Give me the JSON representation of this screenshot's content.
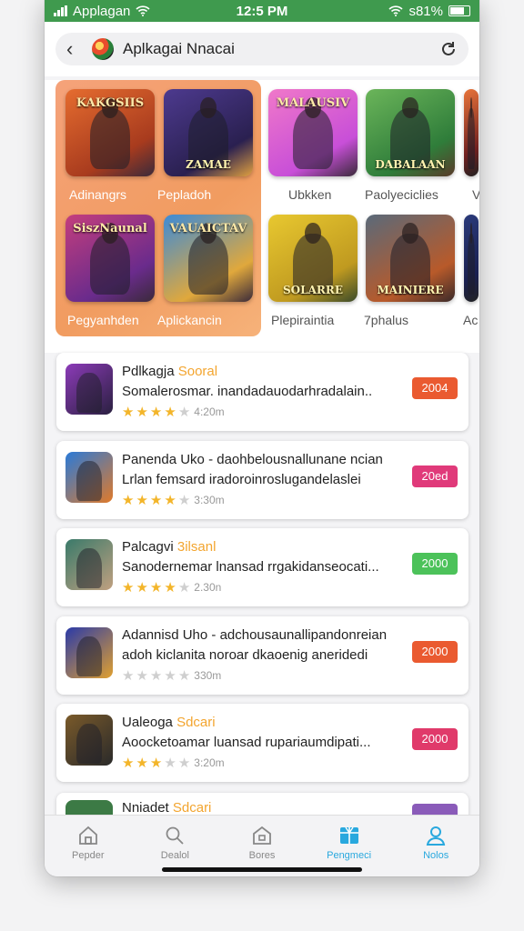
{
  "status_bar": {
    "carrier": "Applagan",
    "time": "12:5 PM",
    "battery_text": "s81%"
  },
  "header": {
    "title": "Aplkagai Nnacai"
  },
  "featured": {
    "tiles": [
      {
        "name": "Adinangrs",
        "top_label": "KAKGSIIS",
        "bottom_label": "",
        "colors": [
          "#e56c2f",
          "#a83b1e",
          "#3a2a3a"
        ]
      },
      {
        "name": "Pepladoh",
        "top_label": "",
        "bottom_label": "ZAMAE",
        "colors": [
          "#4d3a8f",
          "#2a2050",
          "#e0a040"
        ]
      },
      {
        "name": "Ubkken",
        "top_label": "MALAUSIV",
        "bottom_label": "",
        "colors": [
          "#f078c9",
          "#c84fd8",
          "#3a2a3a"
        ]
      },
      {
        "name": "Paolyeciclies",
        "top_label": "",
        "bottom_label": "DABALAAN",
        "colors": [
          "#6bb55a",
          "#2f7d3a",
          "#5a3a2a"
        ]
      },
      {
        "name": "V",
        "top_label": "",
        "bottom_label": "",
        "colors": [
          "#e8743a",
          "#702020",
          "#222"
        ]
      },
      {
        "name": "Pegyanhden",
        "top_label": "SiszNaunal",
        "bottom_label": "",
        "colors": [
          "#c43e7d",
          "#6a2b8c",
          "#3a2a3a"
        ]
      },
      {
        "name": "Aplickancin",
        "top_label": "VAUAICTAV",
        "bottom_label": "",
        "colors": [
          "#3c8bd8",
          "#e0a83c",
          "#3a2a3a"
        ]
      },
      {
        "name": "Plepiraintia",
        "top_label": "",
        "bottom_label": "SOLARRE",
        "colors": [
          "#e8c830",
          "#c09a20",
          "#3a4a2a"
        ]
      },
      {
        "name": "7phalus",
        "top_label": "",
        "bottom_label": "MAINIERE",
        "colors": [
          "#5a6a7a",
          "#b85a2a",
          "#3a2a2a"
        ]
      },
      {
        "name": "Ac",
        "top_label": "",
        "bottom_label": "",
        "colors": [
          "#2a3a7a",
          "#1a2050",
          "#222"
        ]
      }
    ]
  },
  "list": {
    "items": [
      {
        "name": "Pdlkagja",
        "tag": "Sooral",
        "description": "Somalerosmar. inandadauodarhradalain..",
        "rating": 4,
        "half": true,
        "size": "4:20m",
        "price": "2004",
        "price_color": "#ea5a30",
        "icon_colors": [
          "#8c3bb8",
          "#2a2040"
        ]
      },
      {
        "name": "Panenda Uko - daohbelousnallunane ncian",
        "tag": "",
        "description": "Lrlan femsard iradoroinroslugandelaslei",
        "rating": 4,
        "half": false,
        "size": "3:30m",
        "price": "20ed",
        "price_color": "#e03a7a",
        "icon_colors": [
          "#2a7ad8",
          "#e07a2a"
        ]
      },
      {
        "name": "Palcagvi",
        "tag": "3ilsanl",
        "description": "Sanodernemar lnansad rrgakidanseocati...",
        "rating": 4,
        "half": false,
        "size": "2.30n",
        "price": "2000",
        "price_color": "#4cc25a",
        "icon_colors": [
          "#3a7a6a",
          "#c0a080"
        ]
      },
      {
        "name": "Adannisd Uho - adchousaunallipandonreian",
        "tag": "",
        "description": "adoh kiclanita noroar dkaoenig aneridedi",
        "rating": 0,
        "half": false,
        "size": "330m",
        "price": "2000",
        "price_color": "#ea5a30",
        "icon_colors": [
          "#2a3aa8",
          "#e0a030"
        ]
      },
      {
        "name": "Ualeoga",
        "tag": "Sdcari",
        "description": "Aoocketoamar luansad rupariaumdipati...",
        "rating": 3,
        "half": true,
        "size": "3:20m",
        "price": "2000",
        "price_color": "#e03a6a",
        "icon_colors": [
          "#7a5a2a",
          "#2a2a2a"
        ]
      }
    ],
    "peek": {
      "name": "Nniadet",
      "tag": "Sdcari"
    }
  },
  "tabbar": {
    "tabs": [
      {
        "label": "Pepder",
        "icon": "home-icon",
        "active": false
      },
      {
        "label": "Dealol",
        "icon": "search-icon",
        "active": false
      },
      {
        "label": "Bores",
        "icon": "store-icon",
        "active": false
      },
      {
        "label": "Pengmeci",
        "icon": "gift-icon",
        "active": true
      },
      {
        "label": "Nolos",
        "icon": "profile-icon",
        "active": true
      }
    ]
  },
  "colors": {
    "status_bar": "#3f9a4e",
    "featured_panel": "#f19c60",
    "accent_blue": "#29a8de",
    "star": "#f3b52a",
    "tag": "#f3a52f"
  }
}
